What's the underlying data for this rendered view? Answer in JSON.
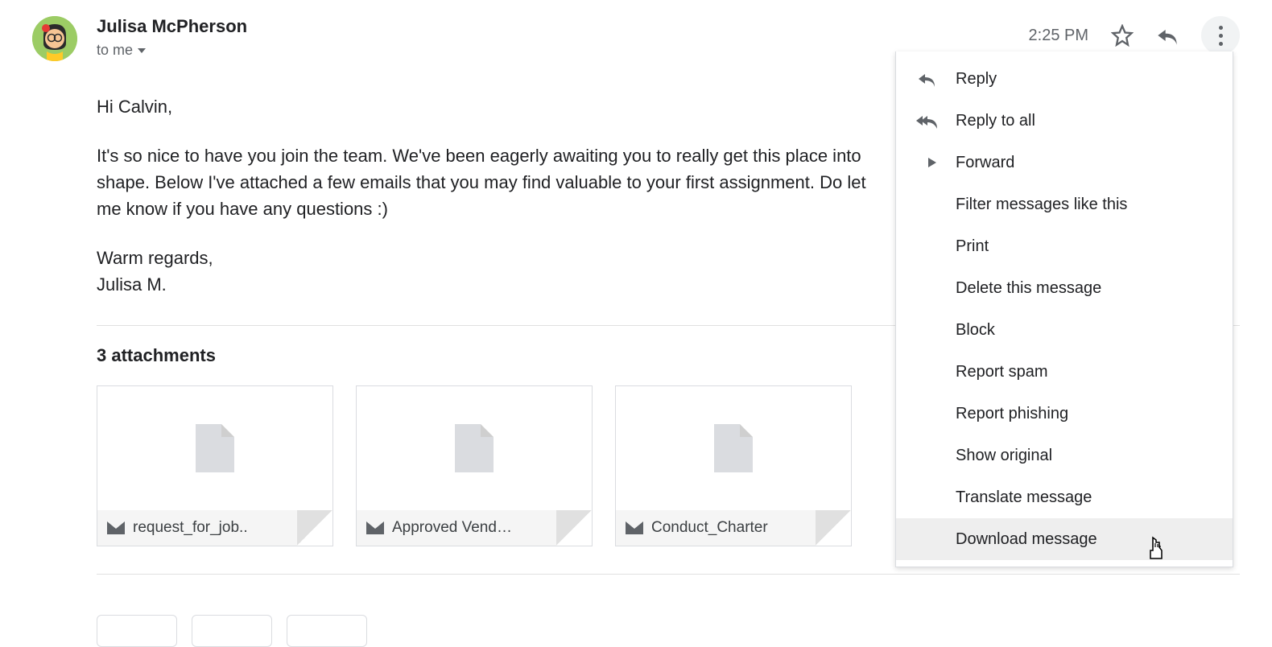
{
  "header": {
    "sender_name": "Julisa McPherson",
    "recipient_text": "to me",
    "timestamp": "2:25 PM"
  },
  "body": {
    "greeting": "Hi Calvin,",
    "paragraph": "It's so nice to have you join the team. We've been eagerly awaiting you to really get this place into shape. Below I've attached a few emails that you may find valuable to your first assignment. Do let me know if you have any questions :)",
    "closing_line1": "Warm regards,",
    "closing_line2": "Julisa M."
  },
  "attachments": {
    "title": "3 attachments",
    "items": [
      {
        "label": "request_for_job.."
      },
      {
        "label": "Approved Vend…"
      },
      {
        "label": "Conduct_Charter"
      }
    ]
  },
  "menu": {
    "items": [
      {
        "label": "Reply",
        "icon": "reply"
      },
      {
        "label": "Reply to all",
        "icon": "reply-all"
      },
      {
        "label": "Forward",
        "icon": "forward"
      },
      {
        "label": "Filter messages like this",
        "icon": ""
      },
      {
        "label": "Print",
        "icon": ""
      },
      {
        "label": "Delete this message",
        "icon": ""
      },
      {
        "label": "Block",
        "icon": ""
      },
      {
        "label": "Report spam",
        "icon": ""
      },
      {
        "label": "Report phishing",
        "icon": ""
      },
      {
        "label": "Show original",
        "icon": ""
      },
      {
        "label": "Translate message",
        "icon": ""
      },
      {
        "label": "Download message",
        "icon": "",
        "hovered": true
      }
    ]
  }
}
